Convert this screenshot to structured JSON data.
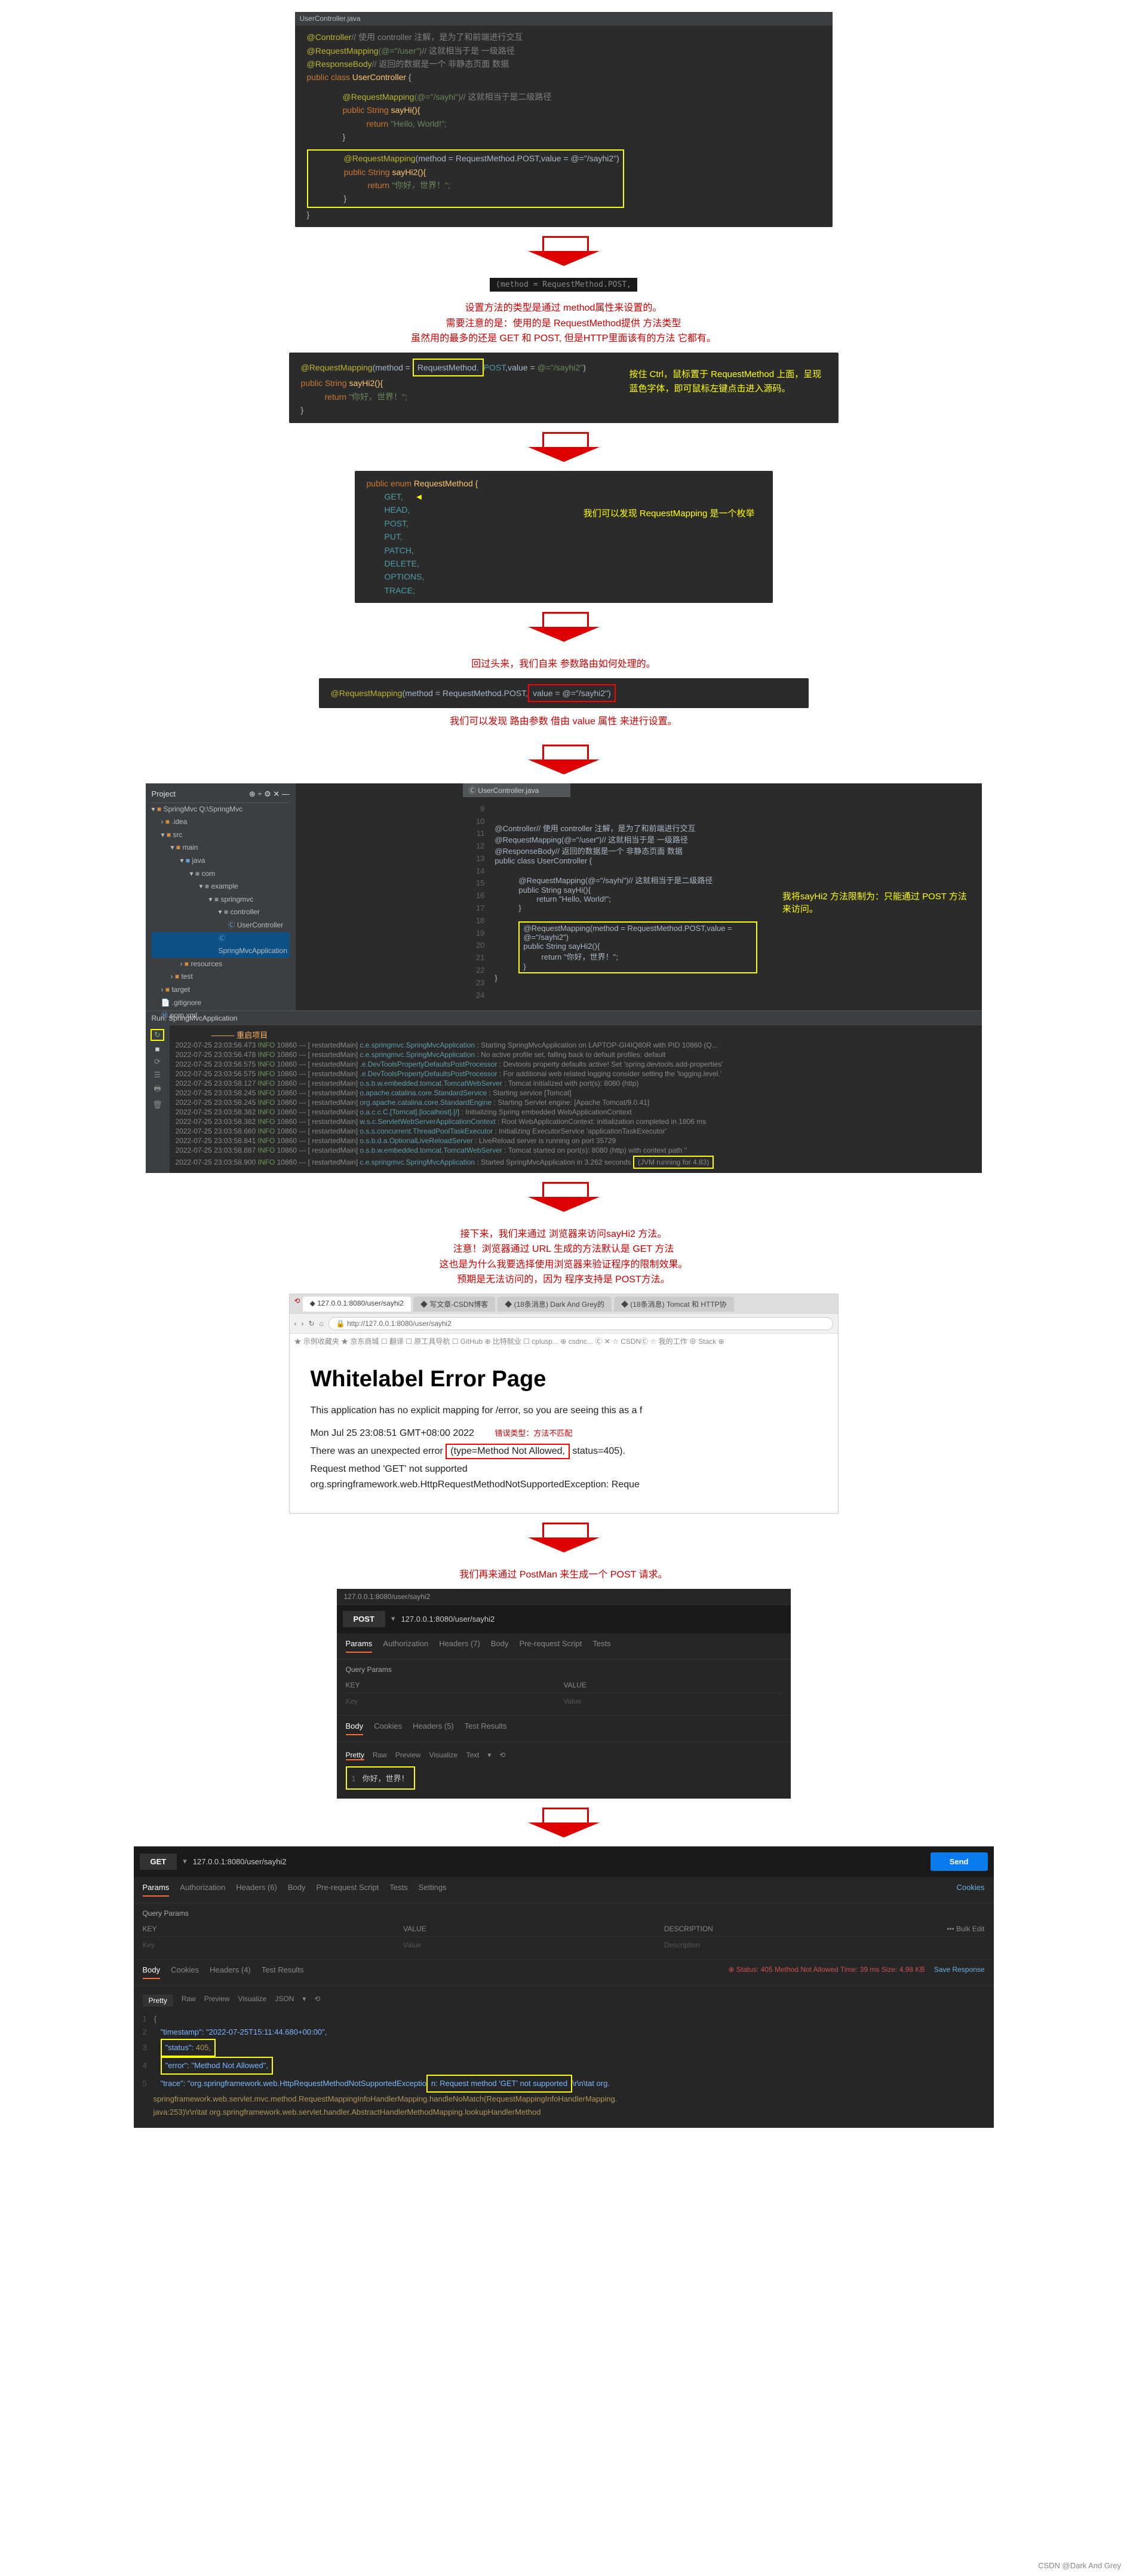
{
  "code1": {
    "file": "UserController.java",
    "l1": "@Controller",
    "l1c": "// 使用 controller 注解，是为了和前端进行交互",
    "l2": "@RequestMapping",
    "l2v": "(@=\"/user\")",
    "l2c": "// 这就相当于是 一级路径",
    "l3": "@ResponseBody",
    "l3c": "// 返回的数据是一个 非静态页面 数据",
    "l4": "public class",
    "l4n": "UserController",
    "l4b": " {",
    "l5": "@RequestMapping",
    "l5v": "(@=\"/sayhi\")",
    "l5c": "// 这就相当于是二级路径",
    "l6": "public String",
    "l6n": "sayHi(){",
    "l7": "return",
    "l7v": "\"Hello, World!\";",
    "l8": "@RequestMapping",
    "l8v": "(method = RequestMethod.POST,value = @=\"/sayhi2\")",
    "l9": "public String",
    "l9n": "sayHi2(){",
    "l10": "return",
    "l10v": "\"你好，世界！\";"
  },
  "darkbox1": "(method = RequestMethod.POST,",
  "txt1": {
    "l1": "设置方法的类型是通过 method属性来设置的。",
    "l2": "需要注意的是：使用的是 RequestMethod提供 方法类型",
    "l3": "虽然用的最多的还是 GET 和 POST, 但是HTTP里面该有的方法 它都有。"
  },
  "code2": {
    "l1": "@RequestMapping",
    "l1v": "(method = RequestMethod.POST,value = @=\"/sayhi2\")",
    "l1box": "RequestMethod.",
    "l2": "public String",
    "l2n": "sayHi2(){",
    "l3": "return",
    "l3v": "\"你好，世界！\";",
    "note1": "按住 Ctrl，鼠标置于 RequestMethod 上面，呈现蓝色字体，即可鼠标左键点击进入源码。"
  },
  "enum1": {
    "head": "public enum",
    "name": "RequestMethod {",
    "items": [
      "GET,",
      "HEAD,",
      "POST,",
      "PUT,",
      "PATCH,",
      "DELETE,",
      "OPTIONS,",
      "TRACE;"
    ],
    "note": "我们可以发现 RequestMapping 是一个枚举"
  },
  "txt2": "回过头来，我们自来 参数路由如何处理的。",
  "code3": {
    "l1": "@RequestMapping",
    "l1a": "(method = RequestMethod.POST,",
    "l1b": "value = @=\"/sayhi2\")"
  },
  "txt3": "我们可以发现 路由参数 借由 value 属性 来进行设置。",
  "ide": {
    "project": "Project",
    "root": "SpringMvc Q:\\SpringMvc",
    "tree": [
      ".idea",
      "src",
      "main",
      "java",
      "com",
      "example",
      "springmvc",
      "controller",
      "UserController",
      "SpringMvcApplication",
      "resources",
      "test",
      "target",
      ".gitignore",
      "pom.xml"
    ],
    "run": "Run: SpringMvcApplication",
    "restart": "重启项目",
    "tab": "UserController.java",
    "note": "我将sayHi2 方法限制为：只能通过 POST 方法来访问。",
    "jvm": "(JVM running for 4.83)",
    "logs": [
      {
        "t": "2022-07-25 23:03:56.473",
        "lv": "INFO",
        "pid": "10860",
        "th": "restartedMain",
        "cls": "c.e.springmvc.SpringMvcApplication",
        "msg": "Starting SpringMvcApplication on LAPTOP-GI4IQ80R with PID 10860 (Q..."
      },
      {
        "t": "2022-07-25 23:03:56.478",
        "lv": "INFO",
        "pid": "10860",
        "th": "restartedMain",
        "cls": "c.e.springmvc.SpringMvcApplication",
        "msg": "No active profile set, falling back to default profiles: default"
      },
      {
        "t": "2022-07-25 23:03:56.575",
        "lv": "INFO",
        "pid": "10860",
        "th": "restartedMain",
        "cls": ".e.DevToolsPropertyDefaultsPostProcessor",
        "msg": "Devtools property defaults active! Set 'spring.devtools.add-properties'"
      },
      {
        "t": "2022-07-25 23:03:56.575",
        "lv": "INFO",
        "pid": "10860",
        "th": "restartedMain",
        "cls": ".e.DevToolsPropertyDefaultsPostProcessor",
        "msg": "For additional web related logging consider setting the 'logging.level.'"
      },
      {
        "t": "2022-07-25 23:03:58.127",
        "lv": "INFO",
        "pid": "10860",
        "th": "restartedMain",
        "cls": "o.s.b.w.embedded.tomcat.TomcatWebServer",
        "msg": "Tomcat initialized with port(s): 8080 (http)"
      },
      {
        "t": "2022-07-25 23:03:58.245",
        "lv": "INFO",
        "pid": "10860",
        "th": "restartedMain",
        "cls": "o.apache.catalina.core.StandardService",
        "msg": "Starting service [Tomcat]"
      },
      {
        "t": "2022-07-25 23:03:58.245",
        "lv": "INFO",
        "pid": "10860",
        "th": "restartedMain",
        "cls": "org.apache.catalina.core.StandardEngine",
        "msg": "Starting Servlet engine: [Apache Tomcat/9.0.41]"
      },
      {
        "t": "2022-07-25 23:03:58.382",
        "lv": "INFO",
        "pid": "10860",
        "th": "restartedMain",
        "cls": "o.a.c.c.C.[Tomcat].[localhost].[/]",
        "msg": "Initializing Spring embedded WebApplicationContext"
      },
      {
        "t": "2022-07-25 23:03:58.382",
        "lv": "INFO",
        "pid": "10860",
        "th": "restartedMain",
        "cls": "w.s.c.ServletWebServerApplicationContext",
        "msg": "Root WebApplicationContext: initialization completed in 1806 ms"
      },
      {
        "t": "2022-07-25 23:03:58.660",
        "lv": "INFO",
        "pid": "10860",
        "th": "restartedMain",
        "cls": "o.s.s.concurrent.ThreadPoolTaskExecutor",
        "msg": "Initializing ExecutorService 'applicationTaskExecutor'"
      },
      {
        "t": "2022-07-25 23:03:58.841",
        "lv": "INFO",
        "pid": "10860",
        "th": "restartedMain",
        "cls": "o.s.b.d.a.OptionalLiveReloadServer",
        "msg": "LiveReload server is running on port 35729"
      },
      {
        "t": "2022-07-25 23:03:58.887",
        "lv": "INFO",
        "pid": "10860",
        "th": "restartedMain",
        "cls": "o.s.b.w.embedded.tomcat.TomcatWebServer",
        "msg": "Tomcat started on port(s): 8080 (http) with context path ''"
      },
      {
        "t": "2022-07-25 23:03:58.900",
        "lv": "INFO",
        "pid": "10860",
        "th": "restartedMain",
        "cls": "c.e.springmvc.SpringMvcApplication",
        "msg": "Started SpringMvcApplication in 3.262 seconds"
      }
    ]
  },
  "txt4": {
    "l1": "接下来，我们来通过 浏览器来访问sayHi2 方法。",
    "l2": "注意！浏览器通过 URL 生成的方法默认是 GET 方法",
    "l3": "这也是为什么我要选择使用浏览器来验证程序的限制效果。",
    "l4": "预期是无法访问的，因为 程序支持是 POST方法。"
  },
  "browser": {
    "url": "http://127.0.0.1:8080/user/sayhi2",
    "urlbar": "127.0.0.1:8080/user/sayhi2",
    "tabs": [
      "◆ 127.0.0.1:8080/user/sayhi2",
      "◆ 写文章-CSDN博客",
      "◆ (18条消息) Dark And Grey的",
      "◆ (18条消息) Tomcat 和 HTTP协"
    ],
    "bookmarks": [
      "★ 示例收藏夹 ★ 京东商城 ☐ 翻译 ☐ 原工具导航 ☐ GitHub ⊕ 比特就业 ☐ cplusp... ⊕ csdnc... Ⓒ ✕ ☆ CSDNⒸ ☆ 我的工作 ⊕ Stack ⊕"
    ],
    "h1": "Whitelabel Error Page",
    "p1": "This application has no explicit mapping for /error, so you are seeing this as a f",
    "p2": "Mon Jul 25 23:08:51 GMT+08:00 2022",
    "err_label": "错误类型：方法不匹配",
    "p3a": "There was an unexpected error",
    "p3b": "(type=Method Not Allowed,",
    "p3c": "status=405).",
    "p4": "Request method 'GET' not supported",
    "p5": "org.springframework.web.HttpRequestMethodNotSupportedException: Reque"
  },
  "txt5": "我们再来通过 PostMan 来生成一个 POST 请求。",
  "pm1": {
    "header": "127.0.0.1:8080/user/sayhi2",
    "method": "POST",
    "url": "127.0.0.1:8080/user/sayhi2",
    "tabs": [
      "Params",
      "Authorization",
      "Headers (7)",
      "Body",
      "Pre-request Script",
      "Tests"
    ],
    "qp": "Query Params",
    "kh": "KEY",
    "vh": "VALUE",
    "kp": "Key",
    "vp": "Value",
    "btabs": [
      "Body",
      "Cookies",
      "Headers (5)",
      "Test Results"
    ],
    "rtabs": [
      "Pretty",
      "Raw",
      "Preview",
      "Visualize",
      "Text"
    ],
    "resp_n": "1",
    "resp": "你好，世界！"
  },
  "pm2": {
    "method": "GET",
    "url": "127.0.0.1:8080/user/sayhi2",
    "send": "Send",
    "cookies": "Cookies",
    "tabs": [
      "Params",
      "Authorization",
      "Headers (6)",
      "Body",
      "Pre-request Script",
      "Tests",
      "Settings"
    ],
    "qp": "Query Params",
    "kh": "KEY",
    "vh": "VALUE",
    "dh": "DESCRIPTION",
    "bulk": "Bulk Edit",
    "kp": "Key",
    "vp": "Value",
    "dp": "Description",
    "btabs": [
      "Body",
      "Cookies",
      "Headers (4)",
      "Test Results"
    ],
    "status": "Status: 405 Method Not Allowed   Time: 39 ms   Size: 4.98 KB",
    "save": "Save Response",
    "rtabs": [
      "Pretty",
      "Raw",
      "Preview",
      "Visualize",
      "JSON"
    ],
    "j1": "\"timestamp\": \"2022-07-25T15:11:44.680+00:00\",",
    "j2k": "\"status\": ",
    "j2v": "405,",
    "j3": "\"error\": \"Method Not Allowed\",",
    "j4a": "\"trace\": \"org.springframework.web.HttpRequestMethodNotSupportedExceptio",
    "j4b": "n: Request method 'GET' not supported",
    "j4c": "\\r\\n\\tat org.",
    "j5": "springframework.web.servlet.mvc.method.RequestMappingInfoHandlerMapping.handleNoMatch(RequestMappingInfoHandlerMapping.",
    "j6": "java:253)\\r\\n\\tat org.springframework.web.servlet.handler.AbstractHandlerMethodMapping.lookupHandlerMethod"
  },
  "watermark": "CSDN @Dark And Grey"
}
